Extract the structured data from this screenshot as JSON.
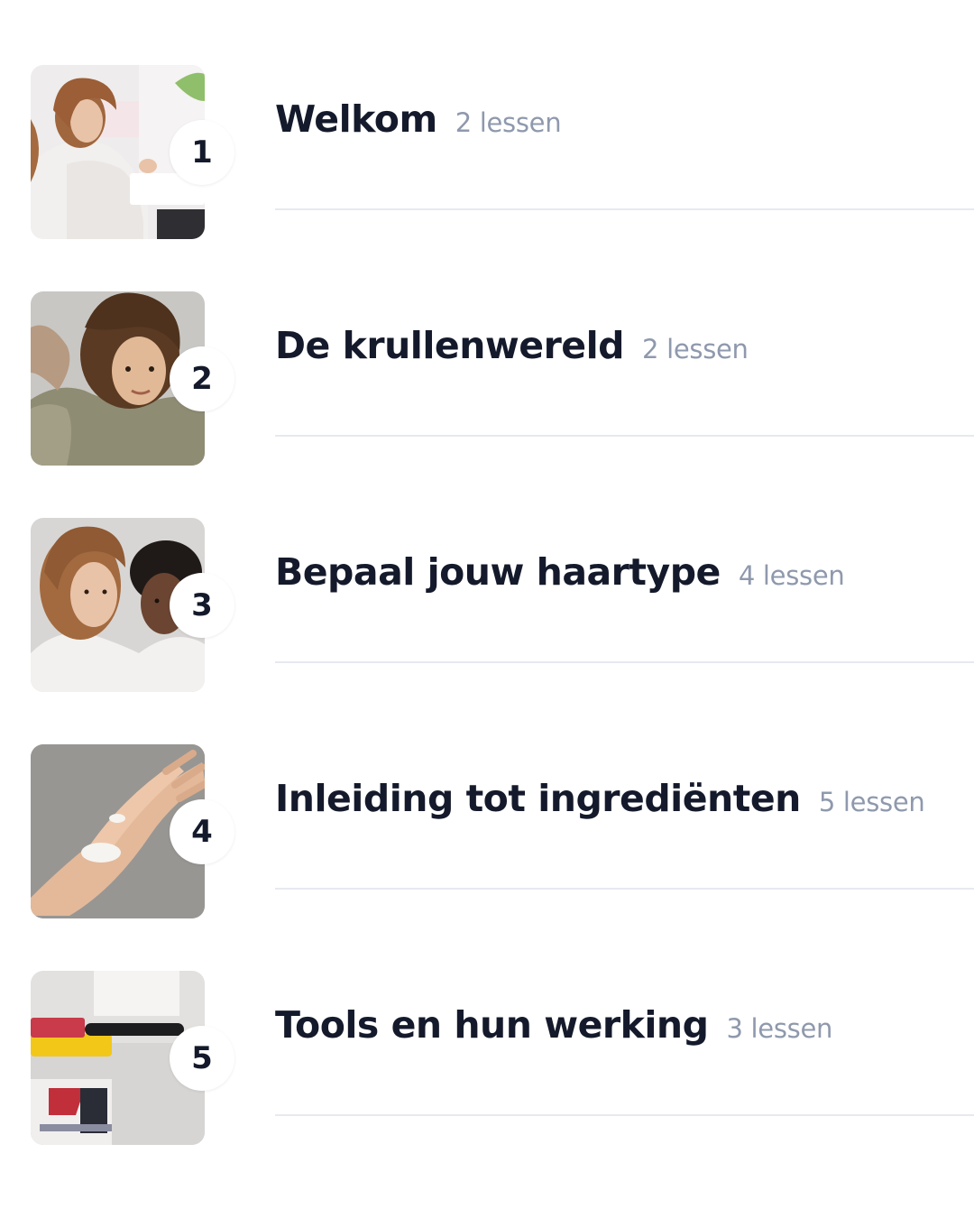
{
  "modules": [
    {
      "number": "1",
      "title": "Welkom",
      "lessons": "2 lessen",
      "thumbnail": "woman-with-product-photo"
    },
    {
      "number": "2",
      "title": "De krullenwereld",
      "lessons": "2 lessen",
      "thumbnail": "curly-hair-portrait-photo"
    },
    {
      "number": "3",
      "title": "Bepaal jouw haartype",
      "lessons": "4 lessen",
      "thumbnail": "two-women-portrait-photo"
    },
    {
      "number": "4",
      "title": "Inleiding tot ingrediënten",
      "lessons": "5 lessen",
      "thumbnail": "cream-on-hand-photo"
    },
    {
      "number": "5",
      "title": "Tools en hun werking",
      "lessons": "3 lessen",
      "thumbnail": "hair-tools-photo"
    }
  ],
  "colors": {
    "title": "#141a2b",
    "lessons": "#8f99ad",
    "divider": "#e7e9f0",
    "badge_bg": "#ffffff"
  }
}
